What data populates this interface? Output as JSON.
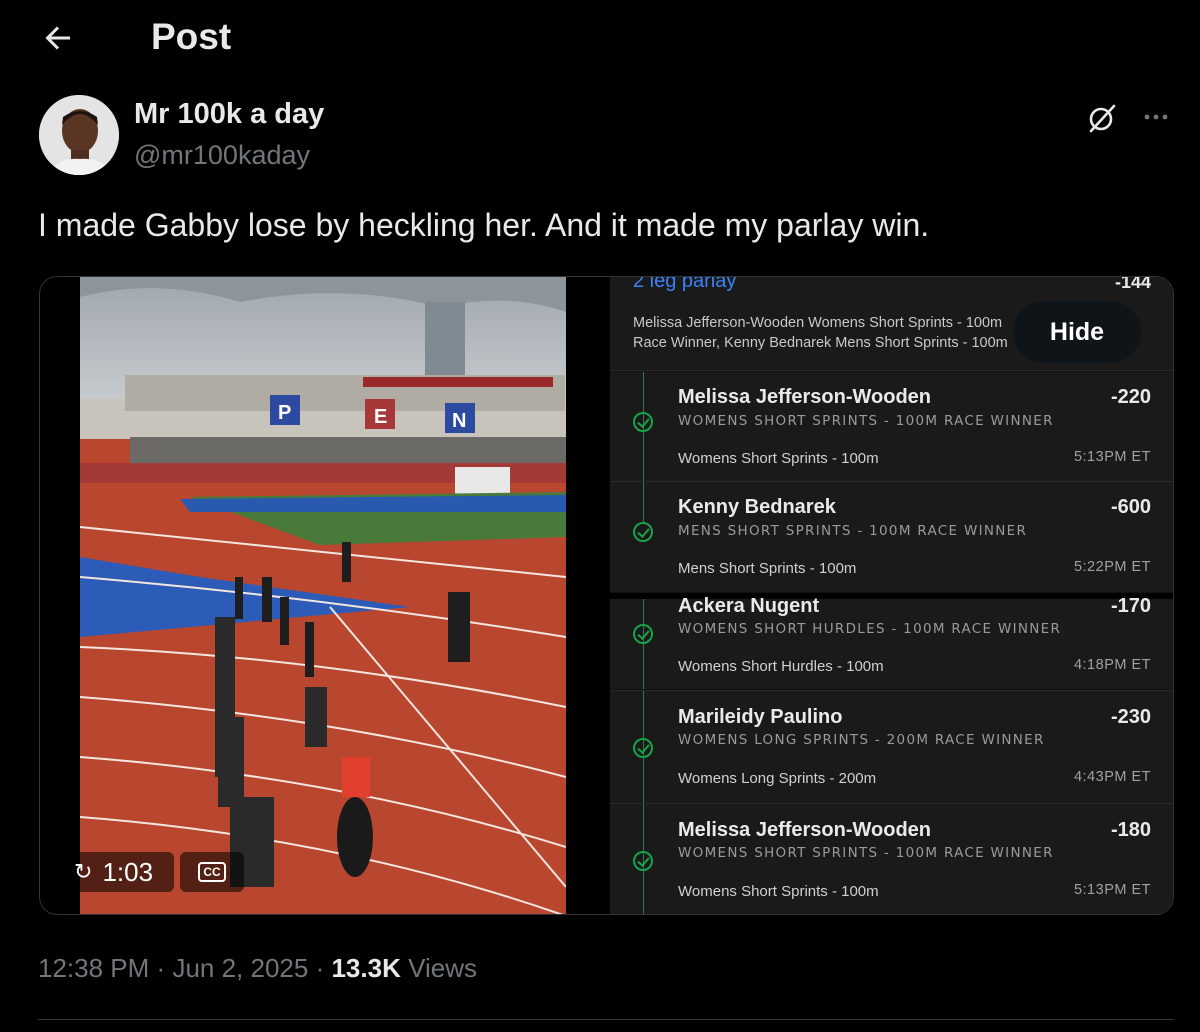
{
  "header": {
    "title": "Post"
  },
  "author": {
    "name": "Mr 100k a day",
    "handle": "@mr100kaday"
  },
  "tweet": {
    "text": "I made Gabby lose by heckling her. And it made my parlay win."
  },
  "video": {
    "duration": "1:03",
    "cc_label": "CC",
    "stadium_letters": [
      "P",
      "E",
      "N"
    ]
  },
  "bet_slip": {
    "title": "2 leg parlay",
    "odds": "-144",
    "description": "Melissa Jefferson-Wooden Womens Short Sprints - 100m Race Winner, Kenny Bednarek Mens Short Sprints - 100m Race Winner",
    "hide_label": "Hide",
    "legs": [
      {
        "name": "Melissa Jefferson-Wooden",
        "odds": "-220",
        "market": "WOMENS SHORT SPRINTS - 100M RACE WINNER",
        "event": "Womens Short Sprints - 100m",
        "time": "5:13PM ET"
      },
      {
        "name": "Kenny Bednarek",
        "odds": "-600",
        "market": "MENS SHORT SPRINTS - 100M RACE WINNER",
        "event": "Mens Short Sprints - 100m",
        "time": "5:22PM ET"
      },
      {
        "name": "Ackera Nugent",
        "odds": "-170",
        "market": "WOMENS SHORT HURDLES - 100M RACE WINNER",
        "event": "Womens Short Hurdles - 100m",
        "time": "4:18PM ET"
      },
      {
        "name": "Marileidy Paulino",
        "odds": "-230",
        "market": "WOMENS LONG SPRINTS - 200M RACE WINNER",
        "event": "Womens Long Sprints - 200m",
        "time": "4:43PM ET"
      },
      {
        "name": "Melissa Jefferson-Wooden",
        "odds": "-180",
        "market": "WOMENS SHORT SPRINTS - 100M RACE WINNER",
        "event": "Womens Short Sprints - 100m",
        "time": "5:13PM ET"
      }
    ]
  },
  "meta": {
    "time": "12:38 PM",
    "date": "Jun 2, 2025",
    "separator": "·",
    "views_count": "13.3K",
    "views_label": "Views"
  },
  "colors": {
    "background": "#000000",
    "text": "#e7e9ea",
    "secondary": "#71767b",
    "link_blue": "#3b82f6",
    "win_green": "#16a34a"
  }
}
